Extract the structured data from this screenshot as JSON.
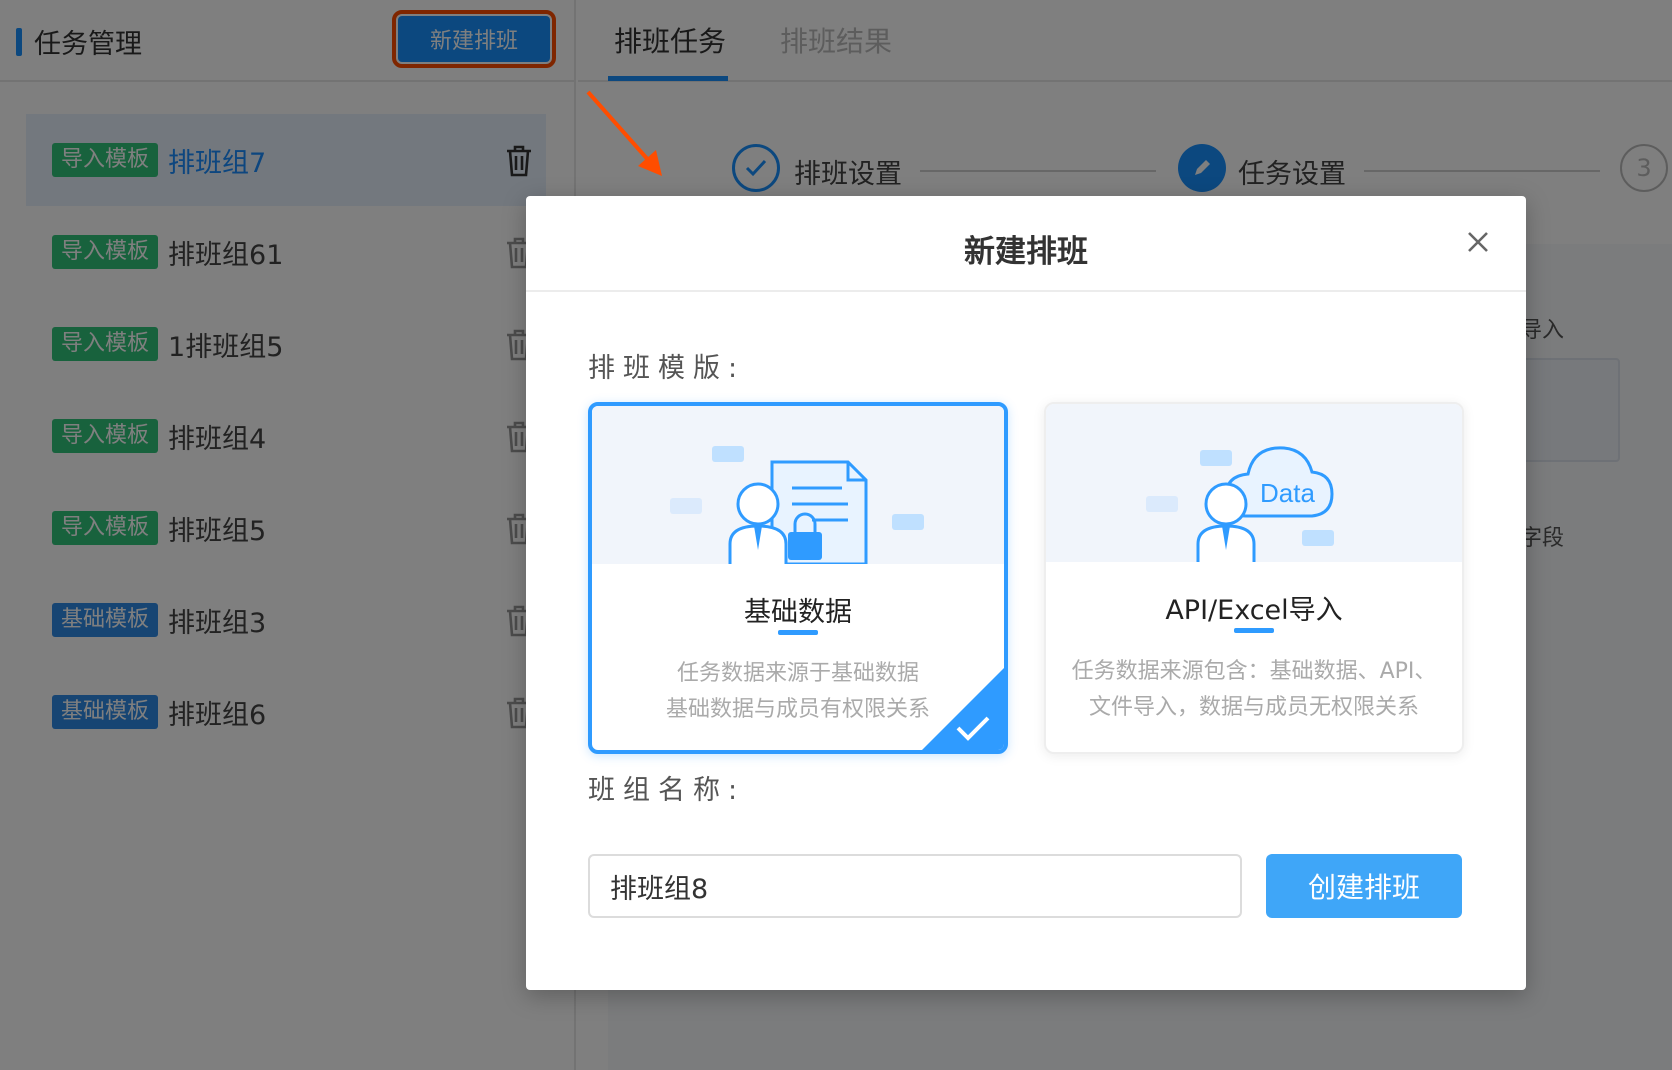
{
  "sidebar": {
    "title": "任务管理",
    "new_button_label": "新建排班",
    "items": [
      {
        "tag": "导入模板",
        "name": "排班组7"
      },
      {
        "tag": "导入模板",
        "name": "排班组61"
      },
      {
        "tag": "导入模板",
        "name": "1排班组5"
      },
      {
        "tag": "导入模板",
        "name": "排班组4"
      },
      {
        "tag": "导入模板",
        "name": "排班组5"
      },
      {
        "tag": "基础模板",
        "name": "排班组3"
      },
      {
        "tag": "基础模板",
        "name": "排班组6"
      }
    ]
  },
  "main": {
    "tabs": [
      {
        "label": "排班任务"
      },
      {
        "label": "排班结果"
      }
    ],
    "steps": [
      {
        "label": "排班设置"
      },
      {
        "label": "任务设置"
      },
      {
        "number": "3"
      }
    ],
    "ghost_texts": [
      "导入",
      "字段"
    ]
  },
  "modal": {
    "title": "新建排班",
    "template_label": "排班模版:",
    "cards": [
      {
        "title": "基础数据",
        "desc_line1": "任务数据来源于基础数据",
        "desc_line2": "基础数据与成员有权限关系"
      },
      {
        "title": "API/Excel导入",
        "illus_text": "Data",
        "desc_line1": "任务数据来源包含：基础数据、API、",
        "desc_line2": "文件导入，数据与成员无权限关系"
      }
    ],
    "name_label": "班组名称:",
    "name_value": "排班组8",
    "create_button_label": "创建排班"
  },
  "colors": {
    "accent": "#1890ff",
    "highlight_outline": "#ff4d00",
    "tag_import": "#30c57a",
    "tag_basic": "#2f8be6"
  }
}
